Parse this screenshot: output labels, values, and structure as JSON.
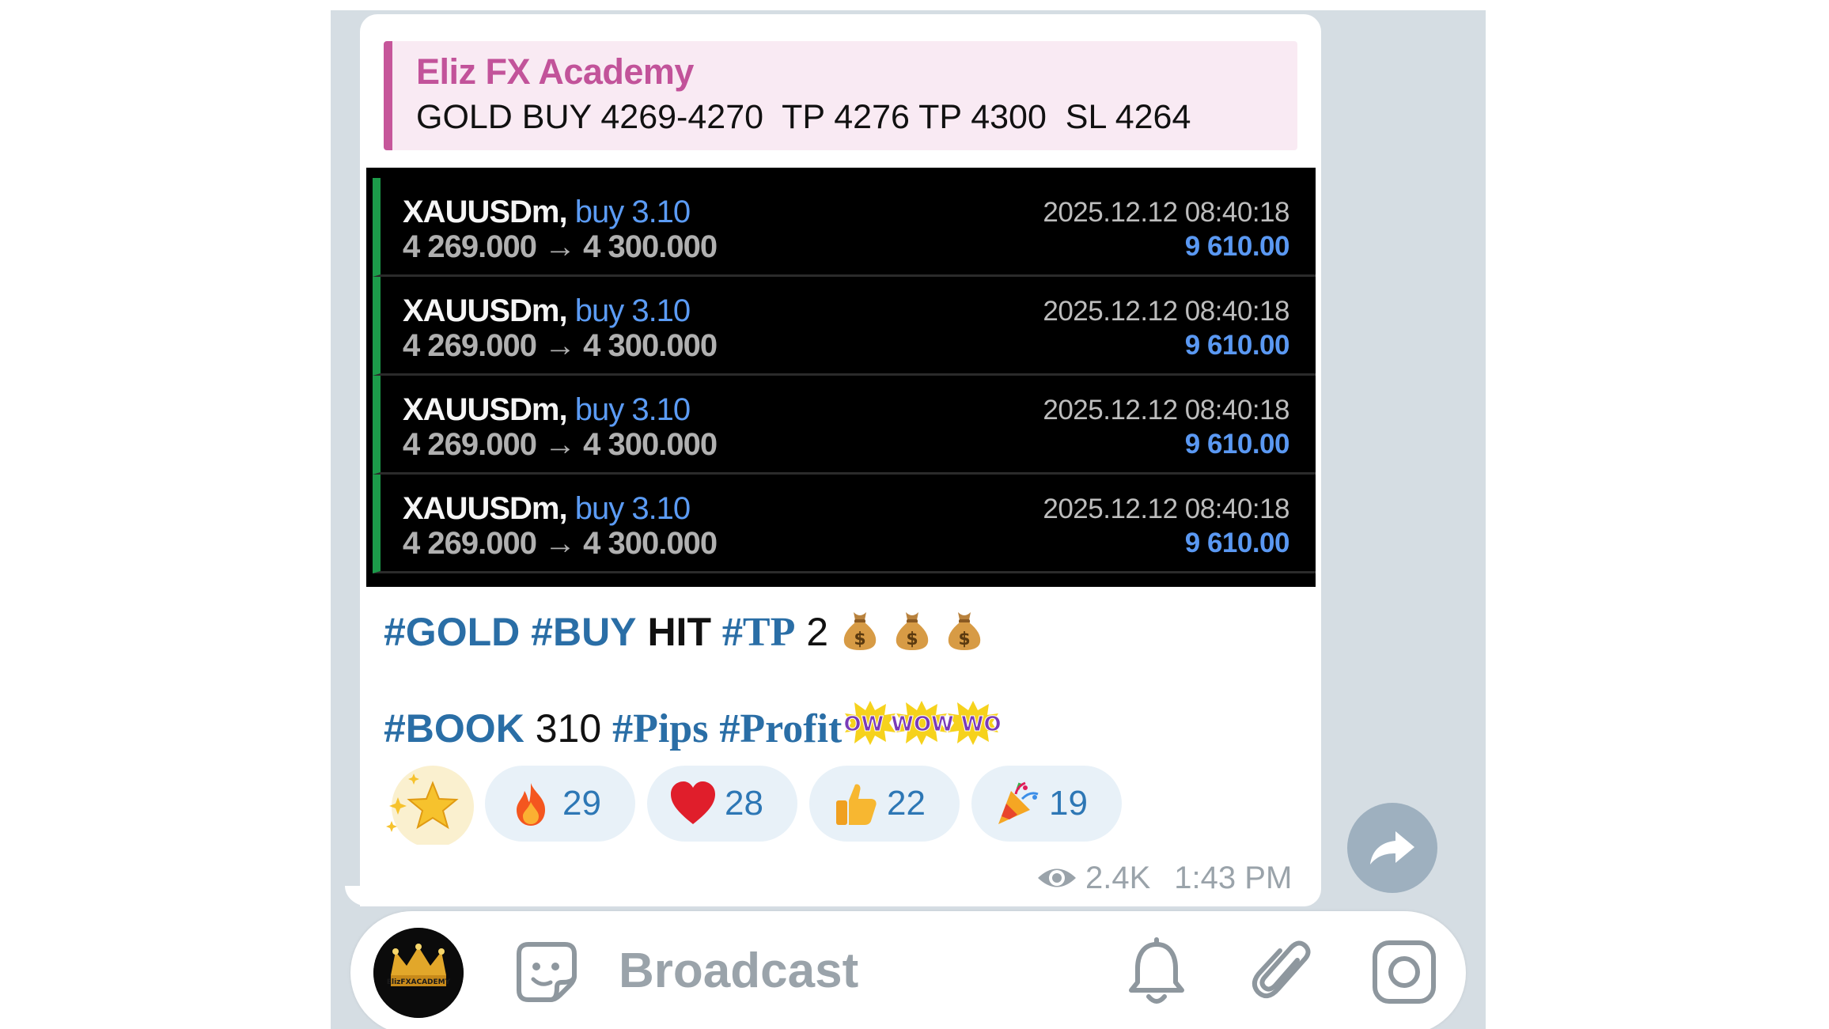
{
  "quote": {
    "author": "Eliz FX Academy",
    "text": "GOLD BUY 4269-4270  TP 4276 TP 4300  SL 4264"
  },
  "trades": [
    {
      "symbol": "XAUUSDm,",
      "side": "buy 3.10",
      "prices": "4 269.000 → 4 300.000",
      "time": "2025.12.12 08:40:18",
      "profit": "9 610.00"
    },
    {
      "symbol": "XAUUSDm,",
      "side": "buy 3.10",
      "prices": "4 269.000 → 4 300.000",
      "time": "2025.12.12 08:40:18",
      "profit": "9 610.00"
    },
    {
      "symbol": "XAUUSDm,",
      "side": "buy 3.10",
      "prices": "4 269.000 → 4 300.000",
      "time": "2025.12.12 08:40:18",
      "profit": "9 610.00"
    },
    {
      "symbol": "XAUUSDm,",
      "side": "buy 3.10",
      "prices": "4 269.000 → 4 300.000",
      "time": "2025.12.12 08:40:18",
      "profit": "9 610.00"
    }
  ],
  "message": {
    "line1": {
      "tag_gold": "#GOLD",
      "tag_buy": "#BUY",
      "hit": "HIT",
      "tag_tp": "#TP",
      "num": "2"
    },
    "line2": {
      "tag_book": "#BOOK",
      "num": "310",
      "tag_pips": "#Pips",
      "tag_profit": "#Profit",
      "wow": "WOW WOW WOW"
    }
  },
  "reactions": [
    {
      "icon": "fire-icon",
      "count": "29"
    },
    {
      "icon": "heart-icon",
      "count": "28"
    },
    {
      "icon": "thumbs-up-icon",
      "count": "22"
    },
    {
      "icon": "party-popper-icon",
      "count": "19"
    }
  ],
  "meta": {
    "views": "2.4K",
    "time": "1:43 PM"
  },
  "bottom_bar": {
    "placeholder": "Broadcast",
    "avatar_text": "ElizFXACADEMY"
  },
  "colors": {
    "quote_accent": "#c6569a",
    "hashtag": "#2a6ea6",
    "trade_green": "#1c9b4a",
    "trade_blue": "#5b9bf4",
    "reaction_bg": "#e8f1f8"
  }
}
